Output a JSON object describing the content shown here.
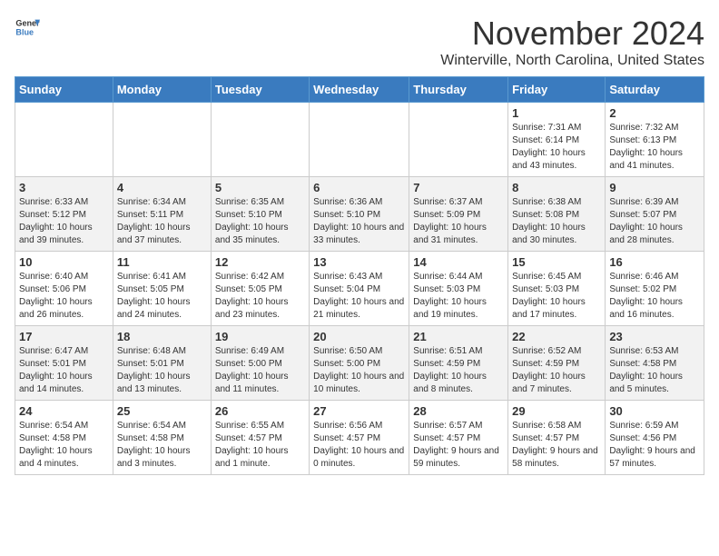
{
  "header": {
    "logo_general": "General",
    "logo_blue": "Blue",
    "month": "November 2024",
    "location": "Winterville, North Carolina, United States"
  },
  "days_of_week": [
    "Sunday",
    "Monday",
    "Tuesday",
    "Wednesday",
    "Thursday",
    "Friday",
    "Saturday"
  ],
  "weeks": [
    [
      {
        "day": "",
        "info": ""
      },
      {
        "day": "",
        "info": ""
      },
      {
        "day": "",
        "info": ""
      },
      {
        "day": "",
        "info": ""
      },
      {
        "day": "",
        "info": ""
      },
      {
        "day": "1",
        "info": "Sunrise: 7:31 AM\nSunset: 6:14 PM\nDaylight: 10 hours and 43 minutes."
      },
      {
        "day": "2",
        "info": "Sunrise: 7:32 AM\nSunset: 6:13 PM\nDaylight: 10 hours and 41 minutes."
      }
    ],
    [
      {
        "day": "3",
        "info": "Sunrise: 6:33 AM\nSunset: 5:12 PM\nDaylight: 10 hours and 39 minutes."
      },
      {
        "day": "4",
        "info": "Sunrise: 6:34 AM\nSunset: 5:11 PM\nDaylight: 10 hours and 37 minutes."
      },
      {
        "day": "5",
        "info": "Sunrise: 6:35 AM\nSunset: 5:10 PM\nDaylight: 10 hours and 35 minutes."
      },
      {
        "day": "6",
        "info": "Sunrise: 6:36 AM\nSunset: 5:10 PM\nDaylight: 10 hours and 33 minutes."
      },
      {
        "day": "7",
        "info": "Sunrise: 6:37 AM\nSunset: 5:09 PM\nDaylight: 10 hours and 31 minutes."
      },
      {
        "day": "8",
        "info": "Sunrise: 6:38 AM\nSunset: 5:08 PM\nDaylight: 10 hours and 30 minutes."
      },
      {
        "day": "9",
        "info": "Sunrise: 6:39 AM\nSunset: 5:07 PM\nDaylight: 10 hours and 28 minutes."
      }
    ],
    [
      {
        "day": "10",
        "info": "Sunrise: 6:40 AM\nSunset: 5:06 PM\nDaylight: 10 hours and 26 minutes."
      },
      {
        "day": "11",
        "info": "Sunrise: 6:41 AM\nSunset: 5:05 PM\nDaylight: 10 hours and 24 minutes."
      },
      {
        "day": "12",
        "info": "Sunrise: 6:42 AM\nSunset: 5:05 PM\nDaylight: 10 hours and 23 minutes."
      },
      {
        "day": "13",
        "info": "Sunrise: 6:43 AM\nSunset: 5:04 PM\nDaylight: 10 hours and 21 minutes."
      },
      {
        "day": "14",
        "info": "Sunrise: 6:44 AM\nSunset: 5:03 PM\nDaylight: 10 hours and 19 minutes."
      },
      {
        "day": "15",
        "info": "Sunrise: 6:45 AM\nSunset: 5:03 PM\nDaylight: 10 hours and 17 minutes."
      },
      {
        "day": "16",
        "info": "Sunrise: 6:46 AM\nSunset: 5:02 PM\nDaylight: 10 hours and 16 minutes."
      }
    ],
    [
      {
        "day": "17",
        "info": "Sunrise: 6:47 AM\nSunset: 5:01 PM\nDaylight: 10 hours and 14 minutes."
      },
      {
        "day": "18",
        "info": "Sunrise: 6:48 AM\nSunset: 5:01 PM\nDaylight: 10 hours and 13 minutes."
      },
      {
        "day": "19",
        "info": "Sunrise: 6:49 AM\nSunset: 5:00 PM\nDaylight: 10 hours and 11 minutes."
      },
      {
        "day": "20",
        "info": "Sunrise: 6:50 AM\nSunset: 5:00 PM\nDaylight: 10 hours and 10 minutes."
      },
      {
        "day": "21",
        "info": "Sunrise: 6:51 AM\nSunset: 4:59 PM\nDaylight: 10 hours and 8 minutes."
      },
      {
        "day": "22",
        "info": "Sunrise: 6:52 AM\nSunset: 4:59 PM\nDaylight: 10 hours and 7 minutes."
      },
      {
        "day": "23",
        "info": "Sunrise: 6:53 AM\nSunset: 4:58 PM\nDaylight: 10 hours and 5 minutes."
      }
    ],
    [
      {
        "day": "24",
        "info": "Sunrise: 6:54 AM\nSunset: 4:58 PM\nDaylight: 10 hours and 4 minutes."
      },
      {
        "day": "25",
        "info": "Sunrise: 6:54 AM\nSunset: 4:58 PM\nDaylight: 10 hours and 3 minutes."
      },
      {
        "day": "26",
        "info": "Sunrise: 6:55 AM\nSunset: 4:57 PM\nDaylight: 10 hours and 1 minute."
      },
      {
        "day": "27",
        "info": "Sunrise: 6:56 AM\nSunset: 4:57 PM\nDaylight: 10 hours and 0 minutes."
      },
      {
        "day": "28",
        "info": "Sunrise: 6:57 AM\nSunset: 4:57 PM\nDaylight: 9 hours and 59 minutes."
      },
      {
        "day": "29",
        "info": "Sunrise: 6:58 AM\nSunset: 4:57 PM\nDaylight: 9 hours and 58 minutes."
      },
      {
        "day": "30",
        "info": "Sunrise: 6:59 AM\nSunset: 4:56 PM\nDaylight: 9 hours and 57 minutes."
      }
    ]
  ]
}
